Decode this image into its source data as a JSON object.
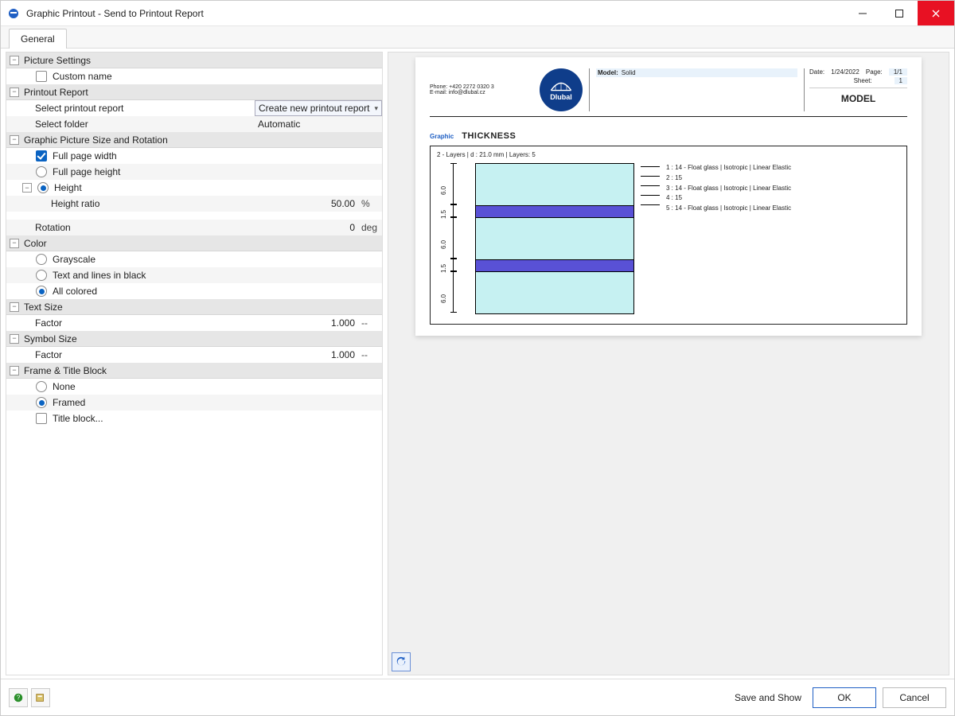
{
  "window": {
    "title": "Graphic Printout - Send to Printout Report"
  },
  "tabs": {
    "general": "General"
  },
  "sections": {
    "picture_settings": {
      "title": "Picture Settings",
      "custom_name": "Custom name"
    },
    "printout_report": {
      "title": "Printout Report",
      "select_report": "Select printout report",
      "select_report_value": "Create new printout report",
      "select_folder": "Select folder",
      "select_folder_value": "Automatic"
    },
    "size_rotation": {
      "title": "Graphic Picture Size and Rotation",
      "full_width": "Full page width",
      "full_height": "Full page height",
      "height": "Height",
      "height_ratio": "Height ratio",
      "height_ratio_value": "50.00",
      "height_ratio_unit": "%",
      "rotation": "Rotation",
      "rotation_value": "0",
      "rotation_unit": "deg"
    },
    "color": {
      "title": "Color",
      "grayscale": "Grayscale",
      "text_black": "Text and lines in black",
      "all_colored": "All colored"
    },
    "text_size": {
      "title": "Text Size",
      "factor": "Factor",
      "value": "1.000",
      "unit": "--"
    },
    "symbol_size": {
      "title": "Symbol Size",
      "factor": "Factor",
      "value": "1.000",
      "unit": "--"
    },
    "frame": {
      "title": "Frame & Title Block",
      "none": "None",
      "framed": "Framed",
      "title_block": "Title block..."
    }
  },
  "preview": {
    "company_phone": "Phone: +420 2272 0320 3",
    "company_email": "E-mail: info@dlubal.cz",
    "logo_text": "Dlubal",
    "model_label": "Model:",
    "model_value": "Solid",
    "date_label": "Date:",
    "date_value": "1/24/2022",
    "page_label": "Page:",
    "page_value": "1/1",
    "sheet_label": "Sheet:",
    "sheet_value": "1",
    "model_big": "MODEL",
    "graphic_label": "Graphic",
    "graphic_title": "THICKNESS",
    "subtitle": "2 - Layers | d : 21.0 mm | Layers: 5",
    "dims": [
      "6.0",
      "1.5",
      "6.0",
      "1.5",
      "6.0"
    ],
    "layer_labels": [
      "1 : 14 - Float glass | Isotropic | Linear Elastic",
      "2 : 15",
      "3 : 14 - Float glass | Isotropic | Linear Elastic",
      "4 : 15",
      "5 : 14 - Float glass | Isotropic | Linear Elastic"
    ]
  },
  "footer": {
    "save_show": "Save and Show",
    "ok": "OK",
    "cancel": "Cancel"
  }
}
